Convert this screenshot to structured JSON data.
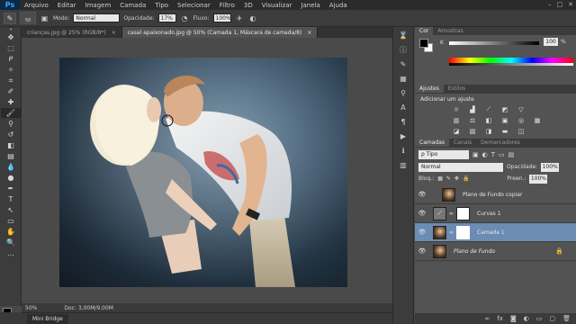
{
  "menu": {
    "logo": "Ps",
    "items": [
      "Arquivo",
      "Editar",
      "Imagem",
      "Camada",
      "Tipo",
      "Selecionar",
      "Filtro",
      "3D",
      "Visualizar",
      "Janela",
      "Ajuda"
    ],
    "window_controls": [
      "–",
      "□",
      "✕"
    ]
  },
  "options": {
    "brush_size": "50",
    "mode_label": "Modo:",
    "mode_value": "Normal",
    "opacity_label": "Opacidade:",
    "opacity_value": "17%",
    "flow_label": "Fluxo:",
    "flow_value": "100%"
  },
  "tabs": [
    {
      "label": "crianças.jpg @ 25% (RGB/8*)",
      "close": "×"
    },
    {
      "label": "casal apaixonado.jpg @ 50% (Camada 1, Máscara de camada/8)",
      "close": "×"
    }
  ],
  "status": {
    "zoom": "50%",
    "doc": "Doc: 3,00M/9,00M"
  },
  "minibridge": "Mini Bridge",
  "panels": {
    "color_tabs": [
      "Cor",
      "Amostras"
    ],
    "color_k_label": "K",
    "color_k_value": "100",
    "color_k_pct": "%",
    "adjust_tabs": [
      "Ajustes",
      "Estilos"
    ],
    "adjust_title": "Adicionar um ajuste",
    "layers_tabs": [
      "Camadas",
      "Canais",
      "Demarcadores"
    ],
    "filter_label": "ρ Tipo",
    "blend_mode": "Normal",
    "opacity_label": "Opacidade:",
    "opacity_value": "100%",
    "lock_label": "Bloq.:",
    "fill_label": "Preen.:",
    "fill_value": "100%"
  },
  "layers": [
    {
      "name": "Plano de Fundo copiar",
      "type": "image",
      "selected": false,
      "italic": false
    },
    {
      "name": "Curvas 1",
      "type": "adjustment",
      "selected": false,
      "italic": false
    },
    {
      "name": "Camada 1",
      "type": "image-mask",
      "selected": true,
      "italic": false
    },
    {
      "name": "Plano de Fundo",
      "type": "image",
      "selected": false,
      "italic": true
    }
  ],
  "colors": {
    "accent_selected": "#6b8cb3",
    "panel_bg": "#535353",
    "menubar_bg": "#2b2b2b"
  }
}
